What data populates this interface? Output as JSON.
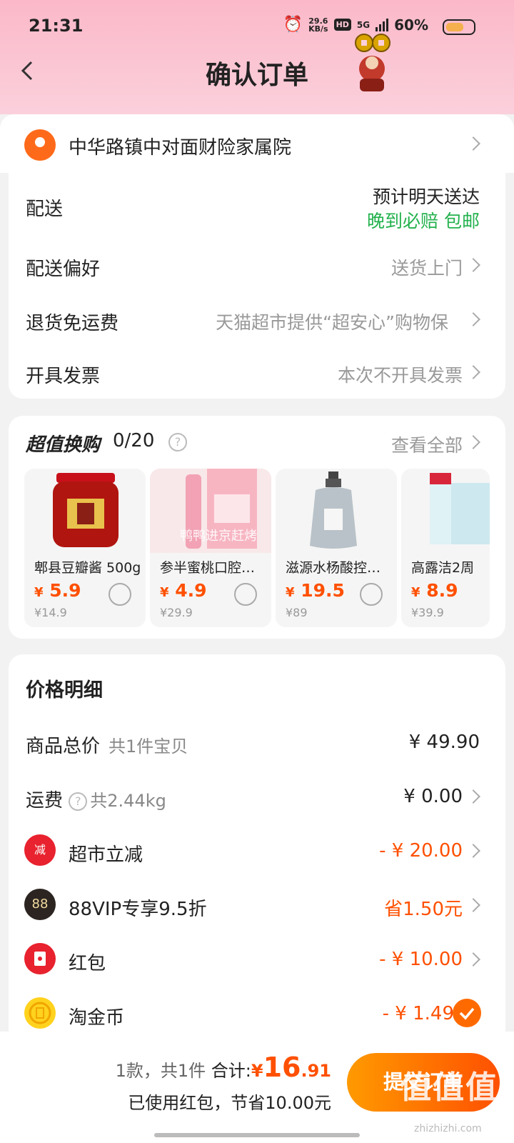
{
  "status_bar": {
    "time": "21:31",
    "speed_top": "29.6",
    "speed_bottom": "KB/s",
    "hd": "HD",
    "network": "5G",
    "battery": "60%"
  },
  "header": {
    "title": "确认订单"
  },
  "address": {
    "text": "中华路镇中对面财险家属院"
  },
  "delivery": {
    "label": "配送",
    "eta": "预计明天送达",
    "guarantee": "晚到必赔 包邮",
    "pref_label": "配送偏好",
    "pref_value": "送货上门",
    "return_label": "退货免运费",
    "return_value": "天猫超市提供“超安心”购物保",
    "invoice_label": "开具发票",
    "invoice_value": "本次不开具发票"
  },
  "exchange": {
    "title": "超值换购",
    "count": "0/20",
    "view_all": "查看全部",
    "watermark": "鸭鸭进京赶烤",
    "products": [
      {
        "name": "郫县豆瓣酱 500g",
        "currency": "¥",
        "price": "5.9",
        "original": "¥14.9"
      },
      {
        "name": "参半蜜桃口腔喷雾",
        "currency": "¥",
        "price": "4.9",
        "original": "¥29.9"
      },
      {
        "name": "滋源水杨酸控油洗发水",
        "currency": "¥",
        "price": "19.5",
        "original": "¥89"
      },
      {
        "name": "高露洁2周",
        "currency": "¥",
        "price": "8.9",
        "original": "¥39.9"
      }
    ]
  },
  "price_detail": {
    "title": "价格明细",
    "goods_label": "商品总价",
    "goods_sub": "共1件宝贝",
    "goods_value": "¥ 49.90",
    "ship_label": "运费",
    "ship_sub": "共2.44kg",
    "ship_value": "¥ 0.00",
    "market_icon": "减",
    "market_label": "超市立减",
    "market_value": "- ¥ 20.00",
    "vip_icon": "88",
    "vip_label": "88VIP专享9.5折",
    "vip_value": "省1.50元",
    "redpack_label": "红包",
    "redpack_value": "- ¥ 10.00",
    "coin_label": "淘金币",
    "coin_value": "- ¥ 1.49"
  },
  "footer": {
    "count": "1款，共1件",
    "total_label": "合计:",
    "currency": "¥",
    "total_int": "16",
    "total_dec": ".91",
    "saved": "已使用红包，节省10.00元",
    "submit": "提交订单",
    "watermark": "值值值",
    "watermark_url": "zhizhizhi.com"
  },
  "colors": {
    "accent": "#ff5000",
    "green": "#22b14c",
    "header_pink": "#fbc7d4"
  }
}
